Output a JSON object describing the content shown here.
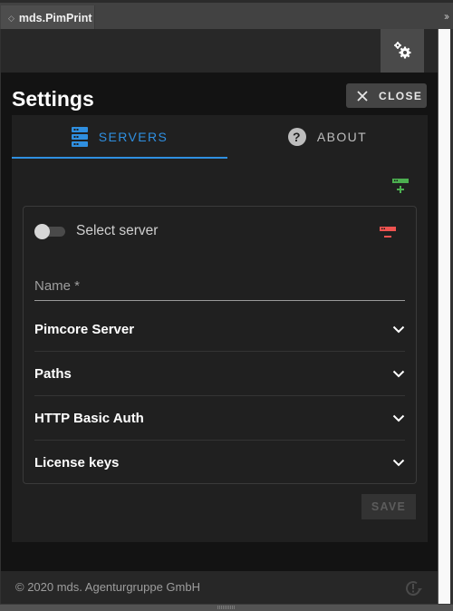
{
  "panel": {
    "tab_label": "mds.PimPrint",
    "collapse_icon": "double-chevron-right-icon"
  },
  "toolbar": {
    "settings_icon": "gears-icon"
  },
  "header": {
    "title": "Settings",
    "close_label": "CLOSE"
  },
  "tabs": [
    {
      "label": "SERVERS",
      "icon": "server-icon",
      "active": true
    },
    {
      "label": "ABOUT",
      "icon": "help-circle-icon",
      "active": false
    }
  ],
  "server": {
    "add_icon": "add-server-icon",
    "remove_icon": "remove-server-icon",
    "select_label": "Select server",
    "select_on": false,
    "name_placeholder": "Name *",
    "name_value": "",
    "sections": [
      {
        "label": "Pimcore Server"
      },
      {
        "label": "Paths"
      },
      {
        "label": "HTTP Basic Auth"
      },
      {
        "label": "License keys"
      }
    ],
    "save_label": "SAVE"
  },
  "footer": {
    "copyright": "© 2020 mds. Agenturgruppe GmbH",
    "update_icon": "update-alert-icon"
  },
  "colors": {
    "accent": "#2f8fe0",
    "add": "#4caf50",
    "remove": "#ef5350"
  }
}
